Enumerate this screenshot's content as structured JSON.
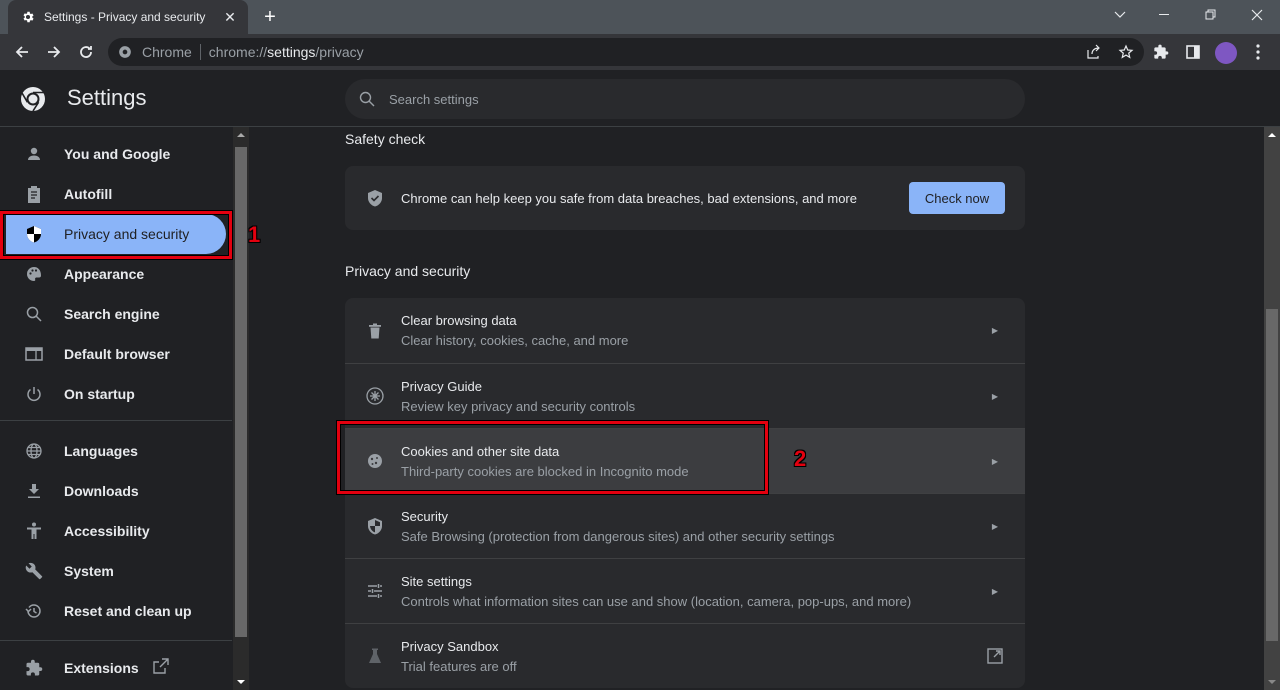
{
  "tab": {
    "title": "Settings - Privacy and security",
    "icon": "gear-icon"
  },
  "omnibox": {
    "site_label": "Chrome",
    "url_prefix": "chrome://",
    "url_host": "settings",
    "url_path": "/privacy"
  },
  "header": {
    "title": "Settings"
  },
  "search": {
    "placeholder": "Search settings"
  },
  "sidebar": {
    "items": [
      {
        "label": "You and Google",
        "icon": "person-icon"
      },
      {
        "label": "Autofill",
        "icon": "clipboard-icon"
      },
      {
        "label": "Privacy and security",
        "icon": "shield-icon",
        "active": true
      },
      {
        "label": "Appearance",
        "icon": "palette-icon"
      },
      {
        "label": "Search engine",
        "icon": "search-icon"
      },
      {
        "label": "Default browser",
        "icon": "browser-icon"
      },
      {
        "label": "On startup",
        "icon": "power-icon"
      },
      {
        "label": "Languages",
        "icon": "globe-icon"
      },
      {
        "label": "Downloads",
        "icon": "download-icon"
      },
      {
        "label": "Accessibility",
        "icon": "accessibility-icon"
      },
      {
        "label": "System",
        "icon": "wrench-icon"
      },
      {
        "label": "Reset and clean up",
        "icon": "restore-icon"
      },
      {
        "label": "Extensions",
        "icon": "puzzle-icon"
      }
    ]
  },
  "safety_check": {
    "title": "Safety check",
    "text": "Chrome can help keep you safe from data breaches, bad extensions, and more",
    "button": "Check now"
  },
  "privacy": {
    "title": "Privacy and security",
    "rows": [
      {
        "title": "Clear browsing data",
        "subtitle": "Clear history, cookies, cache, and more",
        "icon": "trash-icon"
      },
      {
        "title": "Privacy Guide",
        "subtitle": "Review key privacy and security controls",
        "icon": "compass-icon"
      },
      {
        "title": "Cookies and other site data",
        "subtitle": "Third-party cookies are blocked in Incognito mode",
        "icon": "cookie-icon"
      },
      {
        "title": "Security",
        "subtitle": "Safe Browsing (protection from dangerous sites) and other security settings",
        "icon": "shield-icon"
      },
      {
        "title": "Site settings",
        "subtitle": "Controls what information sites can use and show (location, camera, pop-ups, and more)",
        "icon": "tune-icon"
      },
      {
        "title": "Privacy Sandbox",
        "subtitle": "Trial features are off",
        "icon": "flask-icon"
      }
    ]
  },
  "annotations": {
    "first": "1",
    "second": "2"
  },
  "colors": {
    "accent": "#8ab4f8",
    "annotation": "#e3000f",
    "avatar": "#7e57c2"
  }
}
